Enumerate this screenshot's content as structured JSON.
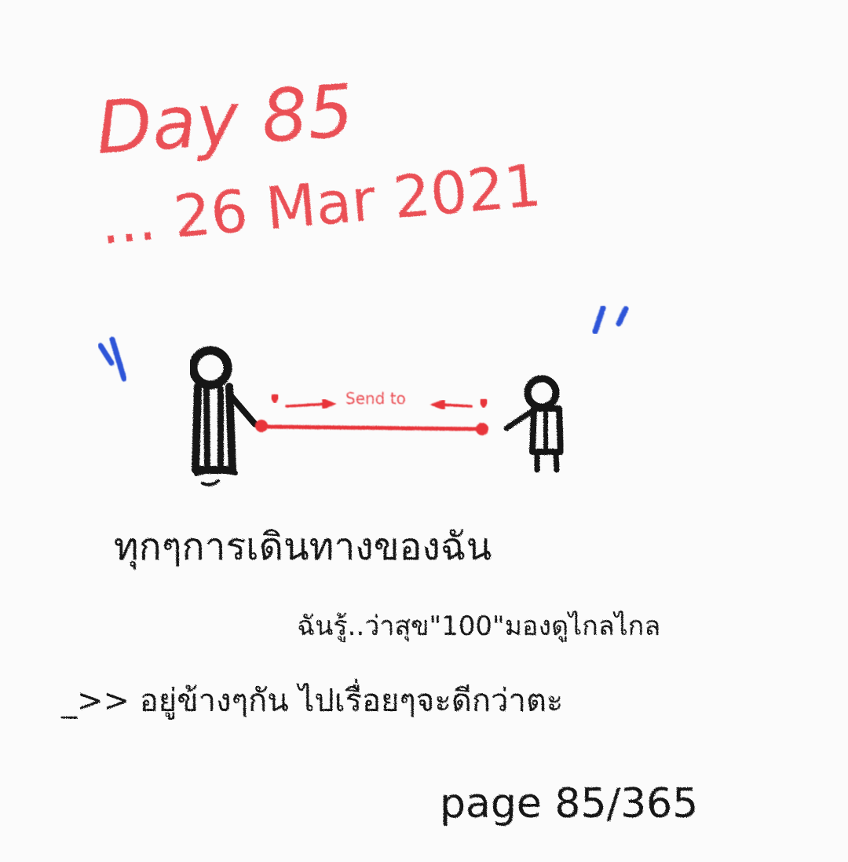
{
  "title_day": "Day 85",
  "title_date": "... 26 Mar 2021",
  "diagram": {
    "arrow_label": "Send to"
  },
  "lines": [
    "ทุกๆการเดินทางของฉัน",
    "ฉันรู้..ว่าสุข\"100\"มองดูไกลไกล",
    "_>> อยู่ข้างๆกัน ไปเรื่อยๆจะดีกว่าตะ"
  ],
  "page_counter": "page 85/365",
  "colors": {
    "red": "#e8343a",
    "black": "#141414",
    "blue": "#2d55d8",
    "paper": "#fbfbfb"
  }
}
